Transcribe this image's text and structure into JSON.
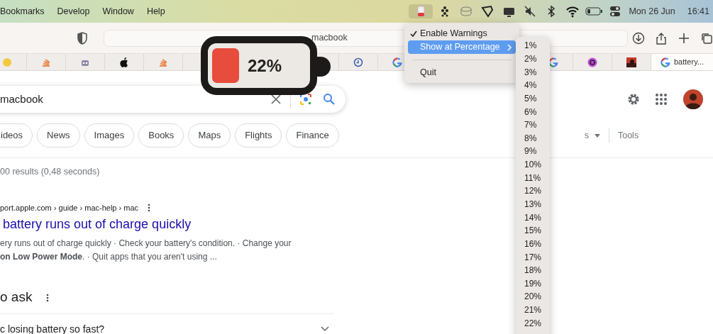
{
  "menu_bar": {
    "items": [
      "Bookmarks",
      "Develop",
      "Window",
      "Help"
    ],
    "date": "Mon 26 Jun",
    "time": "16:41"
  },
  "toolbar": {
    "address": "macbook"
  },
  "favorites": {
    "tab": "battery..."
  },
  "search": {
    "query": "macbook"
  },
  "filters": [
    {
      "label": "ideos"
    },
    {
      "label": "News"
    },
    {
      "label": "Images"
    },
    {
      "label": "Books"
    },
    {
      "label": "Maps"
    },
    {
      "label": "Flights"
    },
    {
      "label": "Finance"
    }
  ],
  "filter_tail": {
    "partial": "s",
    "tools": "Tools"
  },
  "results_count": "00 results (0,48 seconds)",
  "result": {
    "breadcrumb": "port.apple.com › guide › mac-help › mac",
    "title": "battery runs out of charge quickly",
    "snippet": [
      "ery runs out of charge quickly · Check your battery's condition. · Change your",
      "**on Low Power Mode**. · Quit apps that you aren't using ..."
    ]
  },
  "people_also_ask": {
    "heading": "o ask",
    "questions": [
      {
        "text": "c losing battery so fast?",
        "expanded": false
      }
    ]
  },
  "battery_menu": [
    {
      "kind": "item",
      "label": "Enable Warnings",
      "checked": true,
      "selected": false,
      "submenu": false
    },
    {
      "kind": "item",
      "label": "Show at Percentage",
      "checked": false,
      "selected": true,
      "submenu": true
    },
    {
      "kind": "separator"
    },
    {
      "kind": "item",
      "label": "Quit",
      "checked": false,
      "selected": false,
      "submenu": false
    }
  ],
  "percentage_submenu": [
    "1%",
    "2%",
    "3%",
    "4%",
    "5%",
    "6%",
    "7%",
    "8%",
    "9%",
    "10%",
    "11%",
    "12%",
    "13%",
    "14%",
    "15%",
    "16%",
    "17%",
    "18%",
    "19%",
    "20%",
    "21%",
    "22%"
  ],
  "battery_widget": {
    "reading": "22%"
  }
}
